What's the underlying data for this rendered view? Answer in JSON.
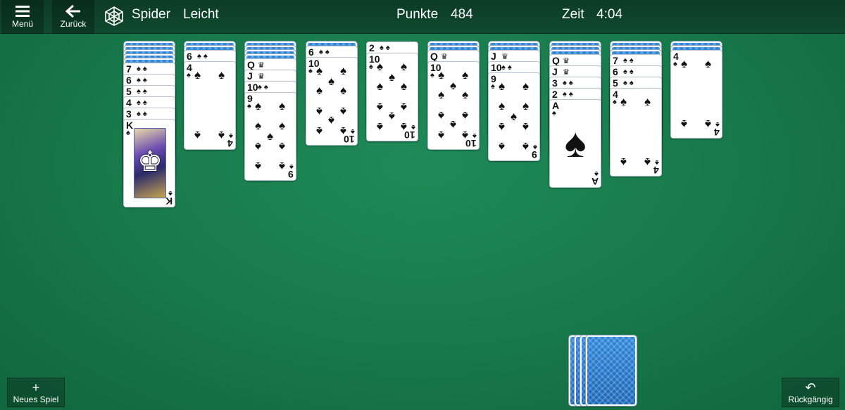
{
  "toolbar": {
    "menu_label": "Menü",
    "back_label": "Zurück",
    "game_name": "Spider",
    "game_level": "Leicht",
    "score_label": "Punkte",
    "score_value": "484",
    "time_label": "Zeit",
    "time_value": "4:04"
  },
  "bottom": {
    "new_game_label": "Neues Spiel",
    "undo_label": "Rückgängig"
  },
  "suit": "♠",
  "columns": [
    {
      "down": 5,
      "up": [
        "7",
        "6",
        "5",
        "4",
        "3",
        "K"
      ]
    },
    {
      "down": 2,
      "up": [
        "6",
        "4"
      ]
    },
    {
      "down": 4,
      "up": [
        "Q",
        "J",
        "10",
        "9"
      ]
    },
    {
      "down": 1,
      "up": [
        "6",
        "10"
      ]
    },
    {
      "down": 0,
      "up": [
        "2",
        "10"
      ]
    },
    {
      "down": 2,
      "up": [
        "Q",
        "10"
      ]
    },
    {
      "down": 2,
      "up": [
        "J",
        "10",
        "9"
      ]
    },
    {
      "down": 3,
      "up": [
        "Q",
        "J",
        "3",
        "2",
        "A"
      ]
    },
    {
      "down": 3,
      "up": [
        "7",
        "6",
        "5",
        "4"
      ]
    },
    {
      "down": 2,
      "up": [
        "4"
      ]
    }
  ],
  "stock_piles": 4,
  "colors": {
    "table_green": "#17784a",
    "top_bar": "#0f4a2f",
    "card_back_blue": "#2e86d8"
  }
}
